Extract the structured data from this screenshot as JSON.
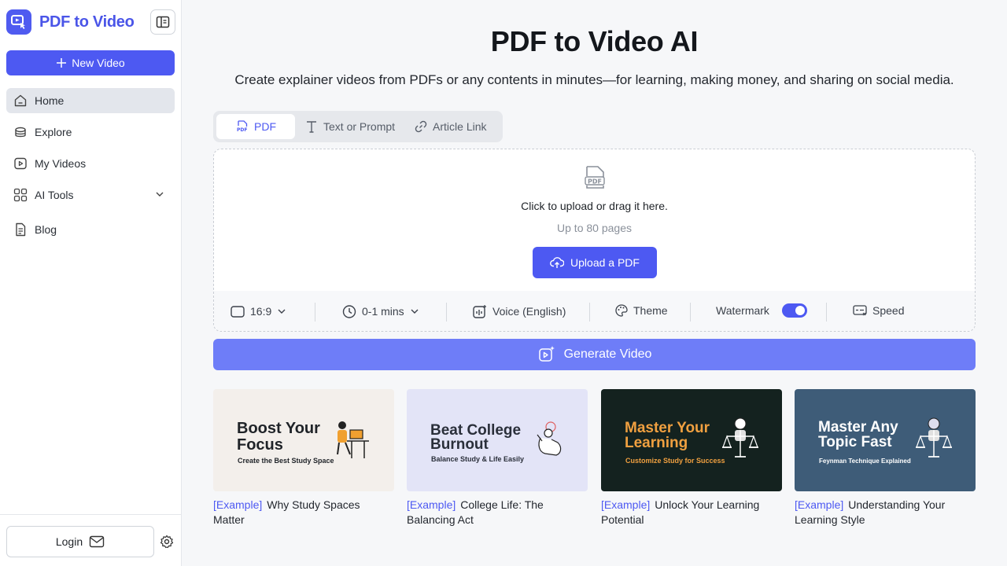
{
  "brand": {
    "name": "PDF to Video"
  },
  "sidebar": {
    "new_video": "New Video",
    "items": [
      {
        "label": "Home",
        "icon": "home-icon"
      },
      {
        "label": "Explore",
        "icon": "explore-icon"
      },
      {
        "label": "My Videos",
        "icon": "video-icon"
      },
      {
        "label": "AI Tools",
        "icon": "grid-icon"
      },
      {
        "label": "Blog",
        "icon": "document-icon"
      }
    ],
    "login": "Login"
  },
  "main": {
    "title": "PDF to Video AI",
    "subtitle": "Create explainer videos from PDFs or any contents in minutes—for learning, making money, and sharing on social media."
  },
  "tabs": [
    {
      "label": "PDF"
    },
    {
      "label": "Text or Prompt"
    },
    {
      "label": "Article Link"
    }
  ],
  "upload": {
    "prompt": "Click to upload or drag it here.",
    "limit": "Up to 80 pages",
    "button": "Upload a PDF"
  },
  "options": {
    "ratio": "16:9",
    "duration": "0-1 mins",
    "voice": "Voice (English)",
    "theme": "Theme",
    "watermark": "Watermark",
    "watermark_on": true,
    "speed": "Speed"
  },
  "generate": "Generate Video",
  "examples": [
    {
      "tag": "[Example]",
      "caption": "Why Study Spaces Matter",
      "thumb_title_1": "Boost Your",
      "thumb_title_2": "Focus",
      "thumb_sub": "Create the Best Study Space",
      "bg": "#f3efeb",
      "title_color": "#1f2328"
    },
    {
      "tag": "[Example]",
      "caption": "College Life: The Balancing Act",
      "thumb_title_1": "Beat College",
      "thumb_title_2": "Burnout",
      "thumb_sub": "Balance Study & Life Easily",
      "bg": "#e3e4f7",
      "title_color": "#2a2f3a"
    },
    {
      "tag": "[Example]",
      "caption": "Unlock Your Learning Potential",
      "thumb_title_1": "Master Your",
      "thumb_title_2": "Learning",
      "thumb_sub": "Customize Study for Success",
      "bg": "#14221f",
      "title_color": "#f0a040"
    },
    {
      "tag": "[Example]",
      "caption": "Understanding Your Learning Style",
      "thumb_title_1": "Master Any",
      "thumb_title_2": "Topic Fast",
      "thumb_sub": "Feynman Technique Explained",
      "bg": "#3e5c78",
      "title_color": "#ffffff"
    }
  ],
  "colors": {
    "accent": "#4d59f2",
    "accent_light": "#6e7df8",
    "brand_text": "#4a55e8"
  }
}
